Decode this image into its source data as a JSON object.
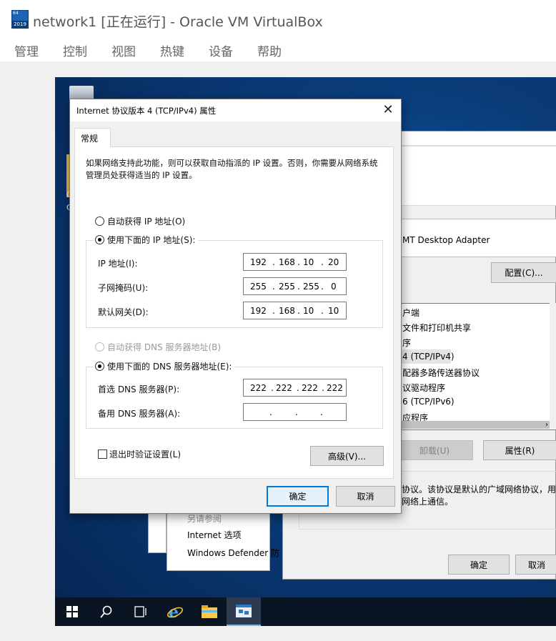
{
  "vbox": {
    "title": "network1 [正在运行] - Oracle VM VirtualBox",
    "logo_tag": "64",
    "logo_year": "2019",
    "menu": [
      "管理",
      "控制",
      "视图",
      "热键",
      "设备",
      "帮助"
    ]
  },
  "dialog": {
    "title": "Internet 协议版本 4 (TCP/IPv4) 属性",
    "tab_general": "常规",
    "description": "如果网络支持此功能，则可以获取自动指派的 IP 设置。否则，你需要从网络系统管理员处获得适当的 IP 设置。",
    "auto_ip_label": "自动获得 IP 地址(O)",
    "manual_ip_label": "使用下面的 IP 地址(S):",
    "ip_label": "IP 地址(I):",
    "ip_value": [
      "192",
      "168",
      "10",
      "20"
    ],
    "subnet_label": "子网掩码(U):",
    "subnet_value": [
      "255",
      "255",
      "255",
      "0"
    ],
    "gateway_label": "默认网关(D):",
    "gateway_value": [
      "192",
      "168",
      "10",
      "10"
    ],
    "auto_dns_label": "自动获得 DNS 服务器地址(B)",
    "manual_dns_label": "使用下面的 DNS 服务器地址(E):",
    "preferred_dns_label": "首选 DNS 服务器(P):",
    "preferred_dns_value": [
      "222",
      "222",
      "222",
      "222"
    ],
    "alternate_dns_label": "备用 DNS 服务器(A):",
    "alternate_dns_value": [
      "",
      "",
      "",
      ""
    ],
    "validate_label": "退出时验证设置(L)",
    "advanced_button": "高级(V)...",
    "ok_button": "确定",
    "cancel_button": "取消"
  },
  "background_panel": {
    "adapter_text": "MT Desktop Adapter",
    "configure_button": "配置(C)...",
    "items": [
      "户端",
      "文件和打印机共享",
      "序",
      "4 (TCP/IPv4)",
      "配器多路传送器协议",
      "议驱动程序",
      "6 (TCP/IPv6)",
      "应程序"
    ],
    "uninstall_button": "卸载(U)",
    "properties_button": "属性(R)",
    "desc_line1": "协议。该协议是默认的广域网络协议，用",
    "desc_line2": "网络上通信。",
    "ok_button": "确定",
    "cancel_button": "取消"
  },
  "background_list": {
    "line0": "另请参阅",
    "line1": "Internet 选项",
    "line2": "Windows Defender 防"
  },
  "desktop": {
    "letter1": "C",
    "letter2": "C"
  }
}
